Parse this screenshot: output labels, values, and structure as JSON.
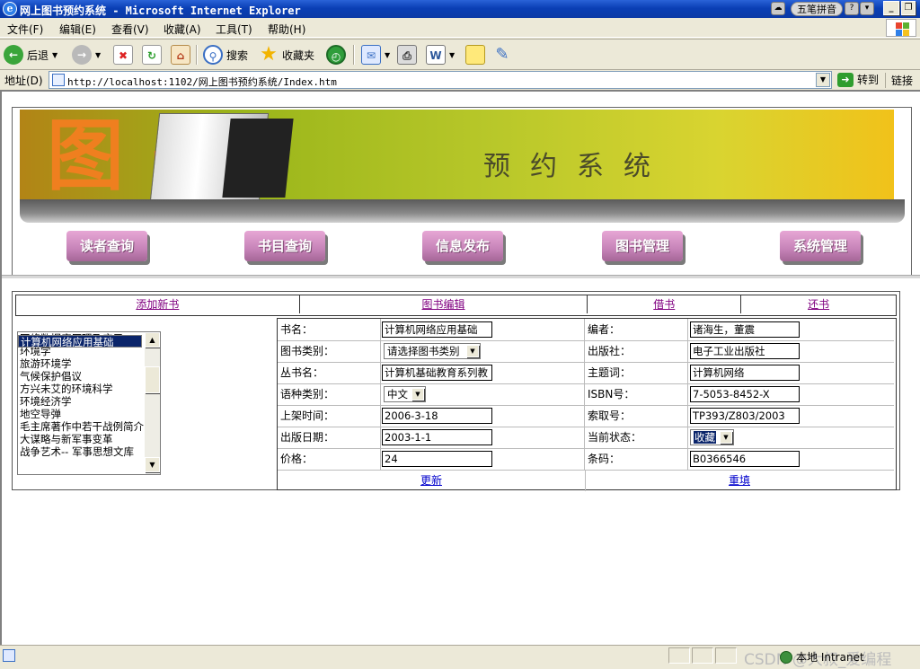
{
  "window": {
    "title": "网上图书预约系统 - Microsoft Internet Explorer",
    "ime_label": "五笔拼音",
    "controls": [
      "_",
      "❐",
      "✕"
    ]
  },
  "menu": [
    "文件(F)",
    "编辑(E)",
    "查看(V)",
    "收藏(A)",
    "工具(T)",
    "帮助(H)"
  ],
  "toolbar": {
    "back": "后退",
    "search": "搜索",
    "favorites": "收藏夹"
  },
  "address": {
    "label": "地址(D)",
    "url": "http://localhost:1102/网上图书预约系统/Index.htm",
    "go": "转到",
    "links": "链接"
  },
  "banner": {
    "big_text": "图书",
    "sub_text": "预约系统"
  },
  "nav": [
    "读者查询",
    "书目查询",
    "信息发布",
    "图书管理",
    "系统管理"
  ],
  "tabs": [
    "添加新书",
    "图书编辑",
    "借书",
    "还书"
  ],
  "book_list": {
    "selected_index": 0,
    "items": [
      "计算机网络应用基础",
      "网络数据库原理及应用",
      "环境学",
      "旅游环境学",
      "气候保护倡议",
      "方兴未艾的环境科学",
      "环境经济学",
      "地空导弹",
      "毛主席著作中若干战例简介",
      "大谋略与新军事变革",
      "战争艺术-- 军事思想文库"
    ]
  },
  "form": {
    "rows": [
      {
        "l_label": "书名：",
        "l_value": "计算机网络应用基础",
        "r_label": "编者：",
        "r_value": "诸海生，董震"
      },
      {
        "l_label": "图书类别：",
        "l_value": "请选择图书类别",
        "r_label": "出版社：",
        "r_value": "电子工业出版社"
      },
      {
        "l_label": "丛书名：",
        "l_value": "计算机基础教育系列教",
        "r_label": "主题词：",
        "r_value": "计算机网络"
      },
      {
        "l_label": "语种类别：",
        "l_value": "中文",
        "r_label": "ISBN号：",
        "r_value": "7-5053-8452-X"
      },
      {
        "l_label": "上架时间：",
        "l_value": "2006-3-18",
        "r_label": "索取号：",
        "r_value": "TP393/Z803/2003"
      },
      {
        "l_label": "出版日期：",
        "l_value": "2003-1-1",
        "r_label": "当前状态：",
        "r_value": "收藏"
      },
      {
        "l_label": "价格：",
        "l_value": "24",
        "r_label": "条码：",
        "r_value": "B0366546"
      }
    ],
    "update": "更新",
    "reset": "重填"
  },
  "status": {
    "zone": "本地 Intranet",
    "watermark": "CSDN @大叔_爱编程"
  }
}
